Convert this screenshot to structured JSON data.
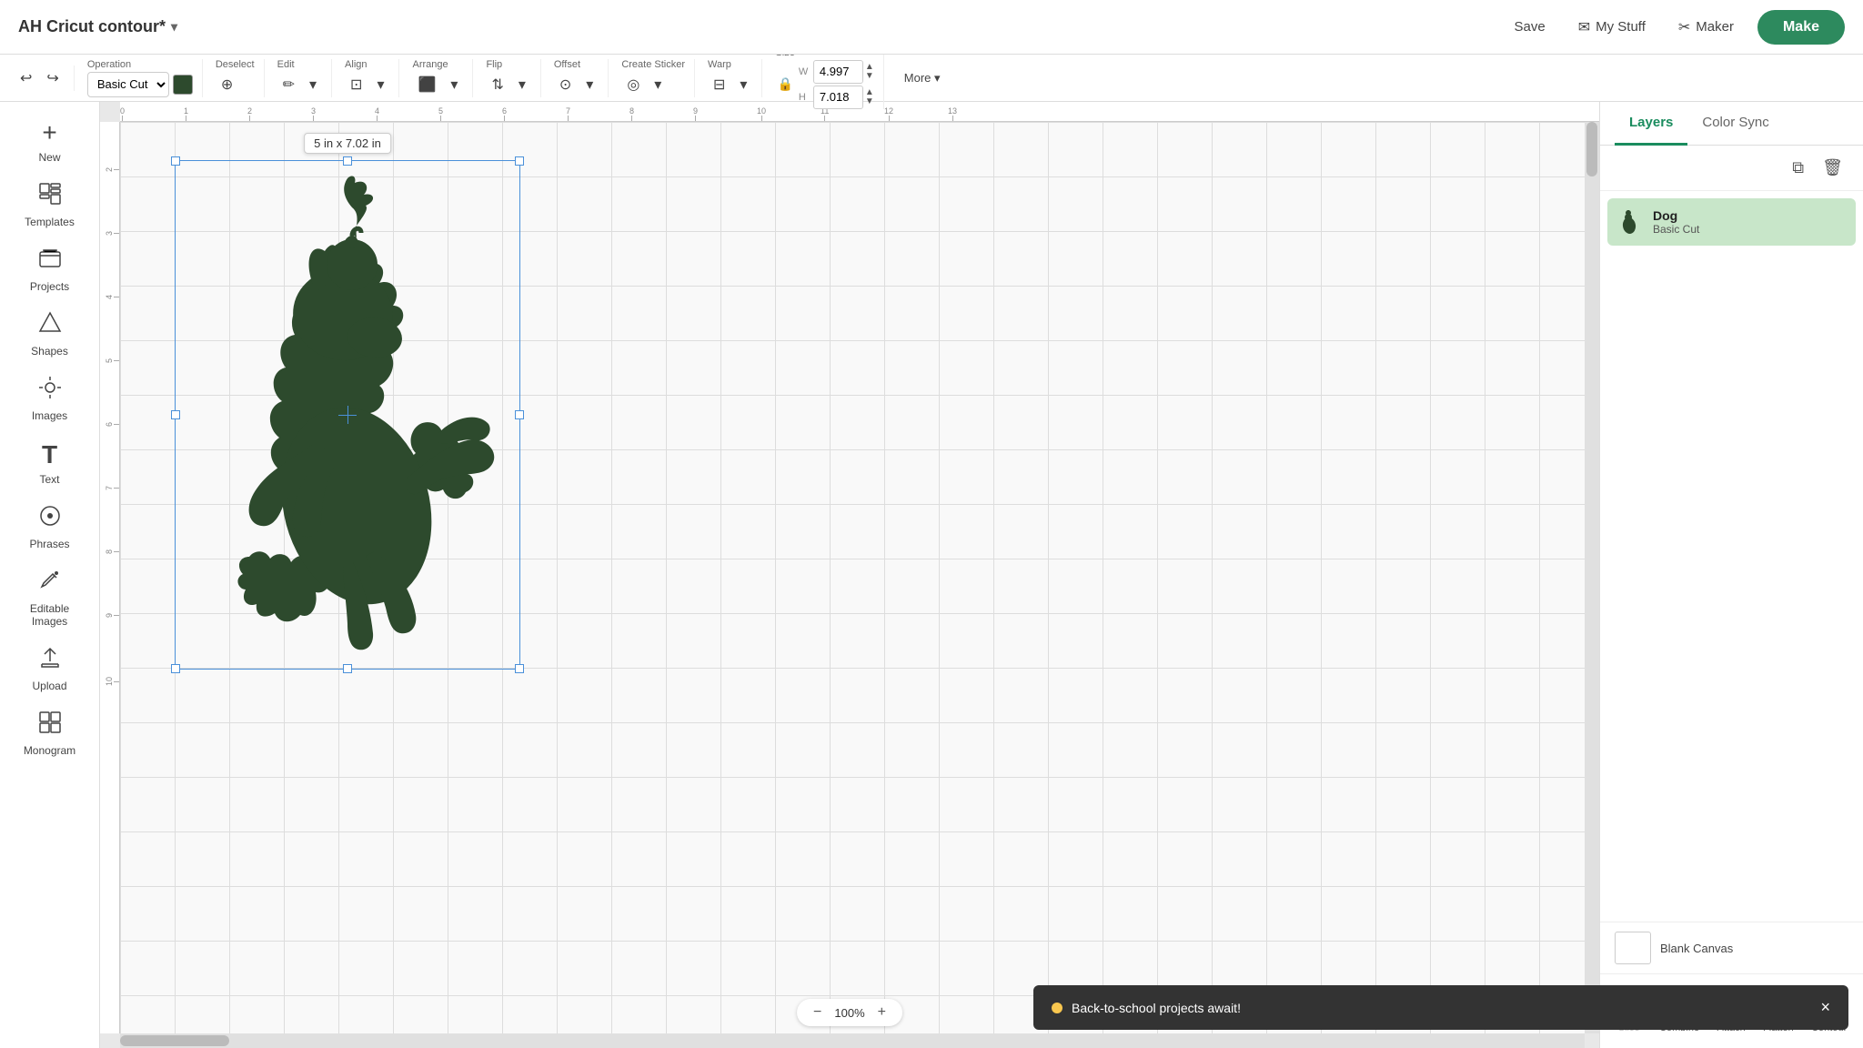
{
  "app": {
    "title": "AH Cricut contour*",
    "caret": "▾"
  },
  "topbar": {
    "save_label": "Save",
    "mystuff_label": "My Stuff",
    "maker_label": "Maker",
    "make_label": "Make"
  },
  "toolbar": {
    "operation_label": "Operation",
    "operation_value": "Basic Cut",
    "deselect_label": "Deselect",
    "edit_label": "Edit",
    "align_label": "Align",
    "arrange_label": "Arrange",
    "flip_label": "Flip",
    "offset_label": "Offset",
    "create_sticker_label": "Create Sticker",
    "warp_label": "Warp",
    "size_label": "Size",
    "w_label": "W",
    "w_value": "4.997",
    "h_label": "H",
    "h_value": "7.018",
    "more_label": "More ▾",
    "undo_icon": "↩",
    "redo_icon": "↪",
    "color_hex": "#2d4a2d"
  },
  "sidebar": {
    "items": [
      {
        "id": "new",
        "label": "New",
        "icon": "+"
      },
      {
        "id": "templates",
        "label": "Templates",
        "icon": "⊞"
      },
      {
        "id": "projects",
        "label": "Projects",
        "icon": "🗂"
      },
      {
        "id": "shapes",
        "label": "Shapes",
        "icon": "△"
      },
      {
        "id": "images",
        "label": "Images",
        "icon": "💡"
      },
      {
        "id": "text",
        "label": "Text",
        "icon": "T"
      },
      {
        "id": "phrases",
        "label": "Phrases",
        "icon": "⊙"
      },
      {
        "id": "editable-images",
        "label": "Editable Images",
        "icon": "✦"
      },
      {
        "id": "upload",
        "label": "Upload",
        "icon": "⬆"
      },
      {
        "id": "monogram",
        "label": "Monogram",
        "icon": "⊞"
      }
    ]
  },
  "canvas": {
    "dimension_tooltip": "5  in x 7.02  in",
    "zoom": "100%",
    "zoom_in": "+",
    "zoom_out": "−",
    "ruler_h_ticks": [
      "0",
      "1",
      "2",
      "3",
      "4",
      "5",
      "6",
      "7",
      "8",
      "9",
      "10",
      "11",
      "12",
      "13"
    ],
    "ruler_v_ticks": [
      "2",
      "3",
      "4",
      "5",
      "6",
      "7",
      "8",
      "9",
      "10"
    ]
  },
  "right_panel": {
    "tab_layers": "Layers",
    "tab_color_sync": "Color Sync",
    "layer_name": "Dog",
    "layer_type": "Basic Cut",
    "blank_canvas_label": "Blank Canvas",
    "copy_icon": "⧉",
    "delete_icon": "🗑"
  },
  "bottom_actions": [
    {
      "id": "slice",
      "label": "Slice",
      "icon": "◪"
    },
    {
      "id": "combine",
      "label": "Combine",
      "icon": "⊕"
    },
    {
      "id": "attach",
      "label": "Attach",
      "icon": "⊟"
    },
    {
      "id": "flatten",
      "label": "Flatten",
      "icon": "⊞"
    },
    {
      "id": "contour",
      "label": "Contour",
      "icon": "◎"
    }
  ],
  "notification": {
    "text": "Back-to-school projects await!",
    "close": "×",
    "dot_color": "#f9c74f"
  }
}
